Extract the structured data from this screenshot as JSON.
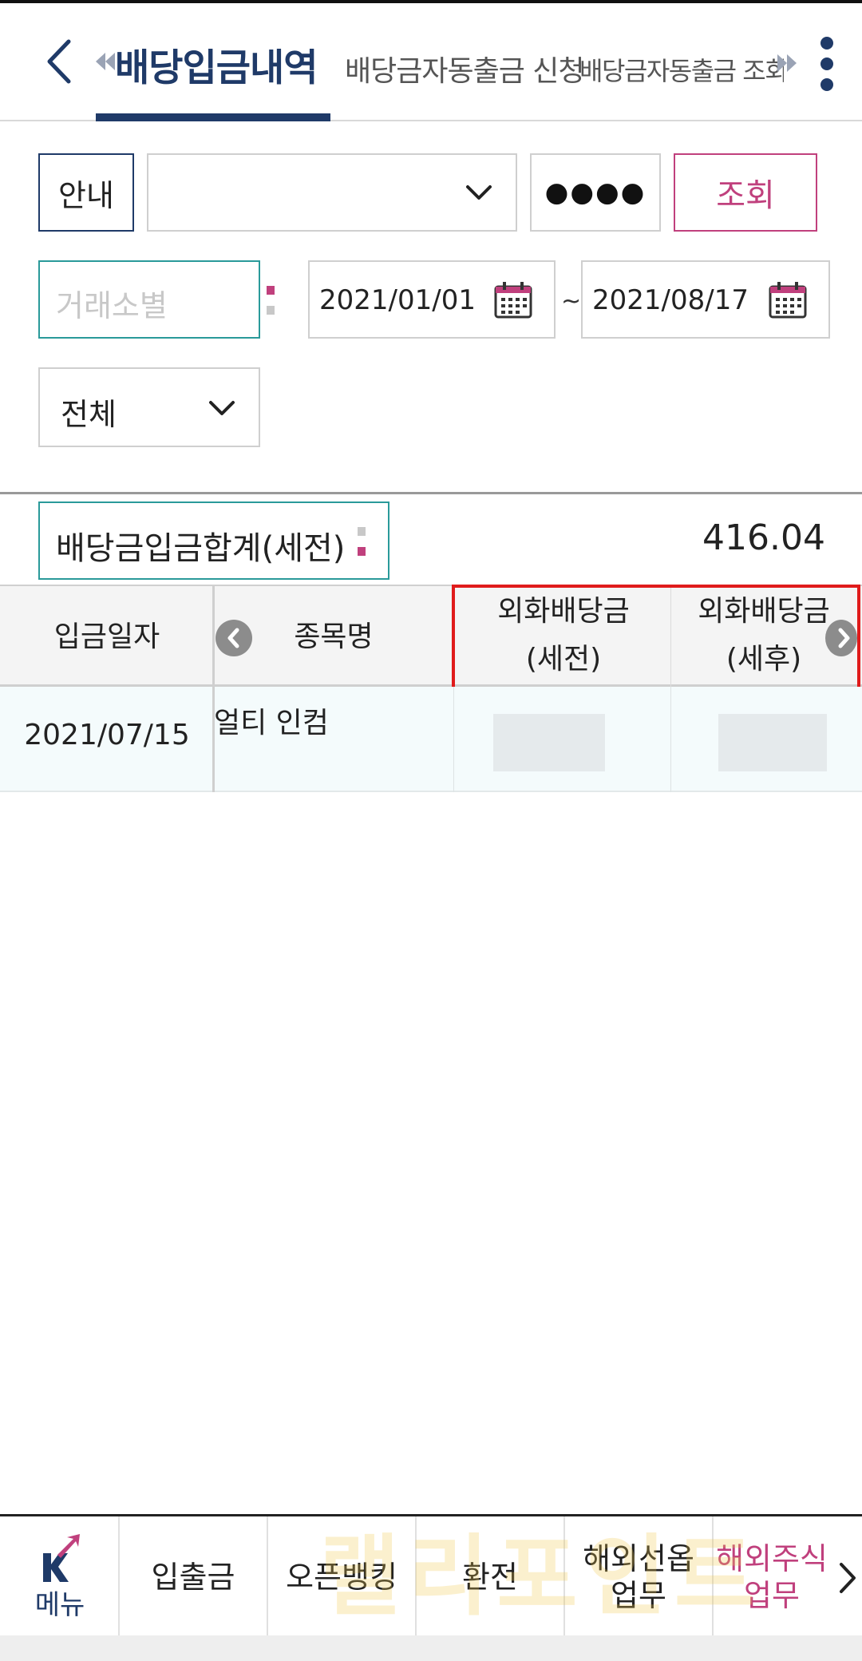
{
  "header": {
    "tabs": [
      {
        "label": "배당입금내역",
        "active": true
      },
      {
        "label": "배당금자동출금 신청"
      },
      {
        "label": "배당금자동출금 조회/해지"
      }
    ]
  },
  "query": {
    "guide_label": "안내",
    "account_value": "",
    "password_mask": "●●●●",
    "query_label": "조회",
    "tx_type_placeholder": "거래소별",
    "date_from": "2021/01/01",
    "date_separator": "~",
    "date_to": "2021/08/17",
    "filter_value": "전체"
  },
  "summary": {
    "label": "배당금입금합계(세전)",
    "value": "416.04"
  },
  "table": {
    "columns": {
      "date": "입금일자",
      "name": "종목명",
      "fx_pre_line1": "외화배당금",
      "fx_pre_line2": "(세전)",
      "fx_post_line1": "외화배당금",
      "fx_post_line2": "(세후)"
    },
    "rows": [
      {
        "date": "2021/07/15",
        "name": "얼티 인컴",
        "fx_pre": "",
        "fx_post": ""
      }
    ]
  },
  "bottom_nav": {
    "menu": "메뉴",
    "deposit": "입출금",
    "openbank": "오픈뱅킹",
    "exchange": "환전",
    "futures_line1": "해외선옵",
    "futures_line2": "업무",
    "stocks_line1": "해외주식",
    "stocks_line2": "업무"
  },
  "watermark": "랠리포인트",
  "colors": {
    "primary": "#1f3a68",
    "accent": "#c0407d",
    "teal": "#2a9a9a",
    "highlight": "#e01b1b"
  }
}
